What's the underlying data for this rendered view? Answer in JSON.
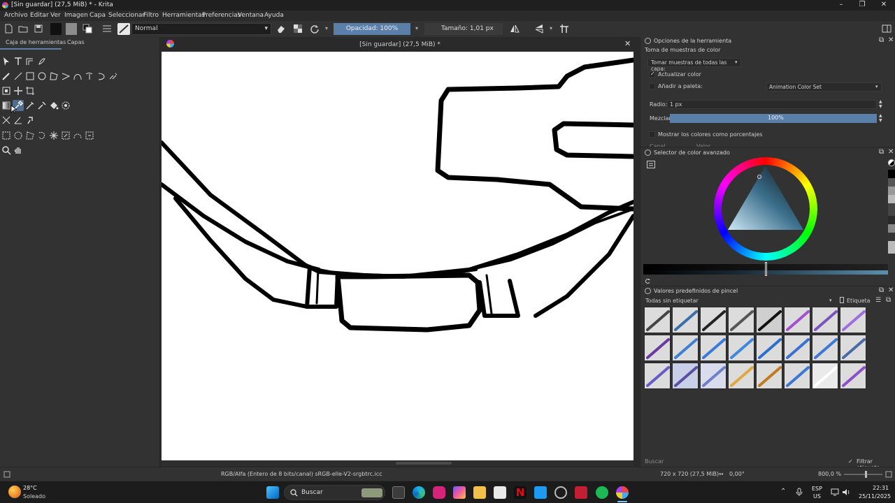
{
  "window": {
    "title": "[Sin guardar]  (27,5 MiB) * - Krita"
  },
  "menu": [
    "Archivo",
    "Editar",
    "Ver",
    "Imagen",
    "Capa",
    "Seleccionar",
    "Filtro",
    "Herramientas",
    "Preferencias",
    "Ventana",
    "Ayuda"
  ],
  "toolbar": {
    "blend_mode": "Normal",
    "opacity": "Opacidad: 100%",
    "size": "Tamaño: 1,01 px"
  },
  "left_dock": {
    "tabs": [
      "Caja de herramientas",
      "Capas"
    ]
  },
  "canvas": {
    "title": "[Sin guardar]  (27,5 MiB) *"
  },
  "tool_options": {
    "header": "Opciones de la herramienta",
    "subtitle": "Toma de muestras de color",
    "sample_mode": "Tomar muestras de todas las capa:",
    "update_color_label": "Actualizar color",
    "add_to_palette_label": "Añadir a paleta:",
    "palette_select": "Animation Color Set",
    "radius_label": "Radio:",
    "radius_value": "1 px",
    "blend_label": "Mezclar:",
    "blend_value": "100%",
    "percent_label": "Mostrar los colores como porcentajes",
    "channel_label": "Canal",
    "value_label": "Valor"
  },
  "color_selector": {
    "header": "Selector de color avanzado"
  },
  "brush_presets": {
    "header": "Valores predefinidos de pincel",
    "tag_filter": "Todas sin etiquetar",
    "tag_label": "Etiqueta",
    "search_placeholder": "Buscar",
    "filter_tag_label": "Filtrar etiqueta"
  },
  "statusbar": {
    "color_profile": "RGB/Alfa (Entero de 8 bits/canal)  sRGB-elle-V2-srgbtrc.icc",
    "image_size": "720 x 720 (27,5 MiB)",
    "rotation": "0,00°",
    "zoom": "800,0 %"
  },
  "taskbar": {
    "weather_temp": "28°C",
    "weather_desc": "Soleado",
    "search": "Buscar",
    "lang": "ESP",
    "region": "US",
    "time": "22:31",
    "date": "25/11/2025"
  },
  "colors": {
    "accent": "#5a7fa8",
    "bg": "#323232",
    "canvas": "#ffffff"
  }
}
